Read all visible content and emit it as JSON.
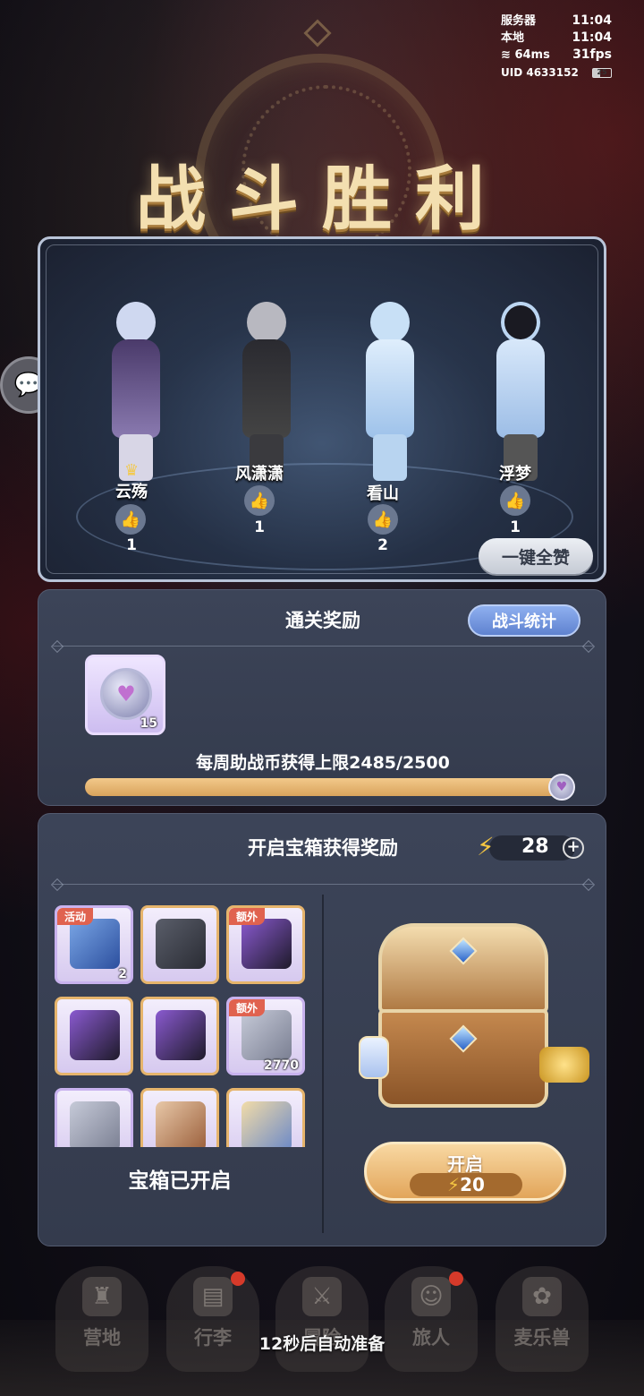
{
  "status": {
    "server_label": "服务器",
    "server_time": "11:04",
    "local_label": "本地",
    "local_time": "11:04",
    "ping": "64ms",
    "fps": "31fps",
    "uid": "UID 4633152",
    "battery": "25"
  },
  "title": "战斗胜利",
  "heroes": [
    {
      "name": "云殇",
      "likes": "1",
      "crown": true
    },
    {
      "name": "风潇潇",
      "likes": "1",
      "crown": false
    },
    {
      "name": "看山",
      "likes": "2",
      "crown": false
    },
    {
      "name": "浮梦",
      "likes": "1",
      "crown": false
    }
  ],
  "like_all_label": "一键全赞",
  "rewards": {
    "title": "通关奖励",
    "stats_button": "战斗统计",
    "item_count": "15",
    "weekly_limit_text": "每周助战币获得上限2485/2500",
    "weekly_progress": 0.994
  },
  "chest": {
    "title": "开启宝箱获得奖励",
    "energy": "28",
    "items": [
      {
        "tag": "活动",
        "count": "2",
        "icon": "shovel-icon"
      },
      {
        "tag": "",
        "count": "",
        "icon": "boots-icon"
      },
      {
        "tag": "额外",
        "count": "",
        "icon": "dagger-icon"
      },
      {
        "tag": "",
        "count": "",
        "icon": "dagger-icon"
      },
      {
        "tag": "",
        "count": "",
        "icon": "dagger-icon"
      },
      {
        "tag": "额外",
        "count": "2770",
        "icon": "iron-ingot-icon"
      },
      {
        "tag": "",
        "count": "",
        "icon": "iron-ingot-icon"
      },
      {
        "tag": "",
        "count": "",
        "icon": "boots-icon"
      },
      {
        "tag": "",
        "count": "",
        "icon": "sword-icon"
      }
    ],
    "opened_text": "宝箱已开启",
    "open_button": "开启",
    "open_cost": "20"
  },
  "nav": {
    "items": [
      "营地",
      "行李",
      "冒险",
      "旅人",
      "麦乐兽"
    ],
    "auto_ready_text": "12秒后自动准备"
  },
  "colors": {
    "accent_gold": "#f3dfb0",
    "stats_blue": "#5f82cf",
    "open_orange": "#e2a55a"
  }
}
